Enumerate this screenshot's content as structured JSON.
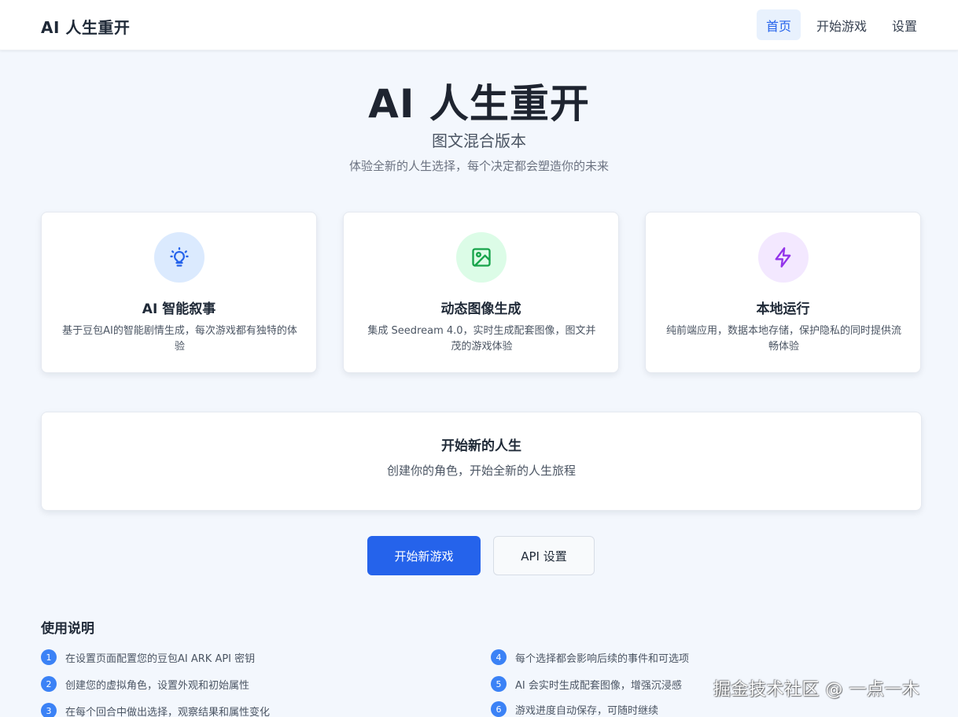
{
  "header": {
    "brand": "AI 人生重开",
    "nav": [
      {
        "label": "首页",
        "active": true
      },
      {
        "label": "开始游戏",
        "active": false
      },
      {
        "label": "设置",
        "active": false
      }
    ]
  },
  "hero": {
    "title": "AI 人生重开",
    "subtitle": "图文混合版本",
    "description": "体验全新的人生选择，每个决定都会塑造你的未来"
  },
  "features": [
    {
      "icon": "lightbulb-icon",
      "title": "AI 智能叙事",
      "description": "基于豆包AI的智能剧情生成，每次游戏都有独特的体验",
      "accent": "#2563eb",
      "bg": "#dbeafe"
    },
    {
      "icon": "image-icon",
      "title": "动态图像生成",
      "description": "集成 Seedream 4.0，实时生成配套图像，图文并茂的游戏体验",
      "accent": "#16a34a",
      "bg": "#dcfce7"
    },
    {
      "icon": "lightning-icon",
      "title": "本地运行",
      "description": "纯前端应用，数据本地存储，保护隐私的同时提供流畅体验",
      "accent": "#9333ea",
      "bg": "#f3e8ff"
    }
  ],
  "start_card": {
    "title": "开始新的人生",
    "description": "创建你的角色，开始全新的人生旅程"
  },
  "actions": {
    "primary_label": "开始新游戏",
    "secondary_label": "API 设置"
  },
  "usage": {
    "title": "使用说明",
    "items": [
      {
        "num": "1",
        "text": "在设置页面配置您的豆包AI ARK API 密钥"
      },
      {
        "num": "2",
        "text": "创建您的虚拟角色，设置外观和初始属性"
      },
      {
        "num": "3",
        "text": "在每个回合中做出选择，观察结果和属性变化"
      },
      {
        "num": "4",
        "text": "每个选择都会影响后续的事件和可选项"
      },
      {
        "num": "5",
        "text": "AI 会实时生成配套图像，增强沉浸感"
      },
      {
        "num": "6",
        "text": "游戏进度自动保存，可随时继续"
      }
    ]
  },
  "watermark": "掘金技术社区 @ 一点一木",
  "colors": {
    "primary": "#2563eb",
    "background": "#f3f7fd",
    "number_badge": "#3b82f6"
  }
}
